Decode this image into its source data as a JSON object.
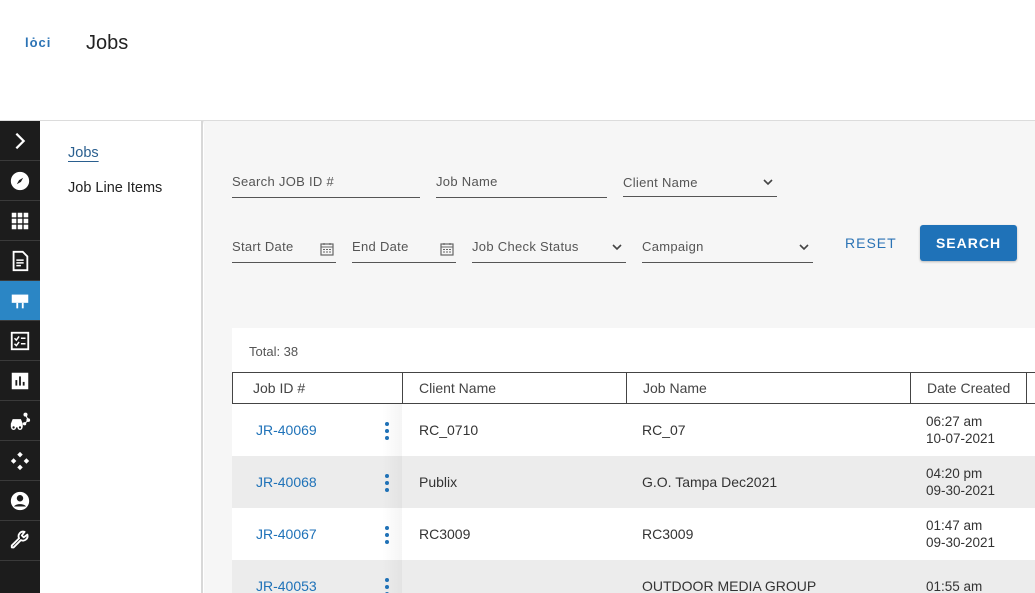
{
  "header": {
    "logo_text": "lȯci",
    "title": "Jobs"
  },
  "rail": {
    "items": [
      {
        "icon": "chevron-right-icon"
      },
      {
        "icon": "compass-icon"
      },
      {
        "icon": "grid-icon"
      },
      {
        "icon": "document-icon"
      },
      {
        "icon": "billboard-icon",
        "active": true
      },
      {
        "icon": "checklist-icon"
      },
      {
        "icon": "bar-chart-icon"
      },
      {
        "icon": "vehicle-route-icon"
      },
      {
        "icon": "diamond-network-icon"
      },
      {
        "icon": "user-circle-icon"
      },
      {
        "icon": "wrench-icon"
      }
    ]
  },
  "subnav": {
    "items": [
      {
        "label": "Jobs",
        "active": true
      },
      {
        "label": "Job Line Items"
      }
    ]
  },
  "filters": {
    "search_job_id": "Search JOB ID #",
    "job_name": "Job Name",
    "client_name": "Client Name",
    "start_date": "Start Date",
    "end_date": "End Date",
    "job_check_status": "Job Check Status",
    "campaign": "Campaign",
    "reset_label": "RESET",
    "search_label": "SEARCH"
  },
  "table": {
    "total": "Total: 38",
    "columns": [
      "Job ID #",
      "Client Name",
      "Job Name",
      "Date Created"
    ],
    "rows": [
      {
        "job_id": "JR-40069",
        "client": "RC_0710",
        "job_name": "RC_07",
        "time": "06:27 am",
        "date": "10-07-2021"
      },
      {
        "job_id": "JR-40068",
        "client": "Publix",
        "job_name": "G.O. Tampa Dec2021",
        "time": "04:20 pm",
        "date": "09-30-2021"
      },
      {
        "job_id": "JR-40067",
        "client": "RC3009",
        "job_name": "RC3009",
        "time": "01:47 am",
        "date": "09-30-2021"
      },
      {
        "job_id": "JR-40053",
        "client": "",
        "job_name": "OUTDOOR MEDIA GROUP",
        "time": "01:55 am",
        "date": ""
      }
    ]
  },
  "colors": {
    "accent": "#1f72b8",
    "rail_bg": "#1c1c1c",
    "rail_active": "#2b86c5"
  }
}
